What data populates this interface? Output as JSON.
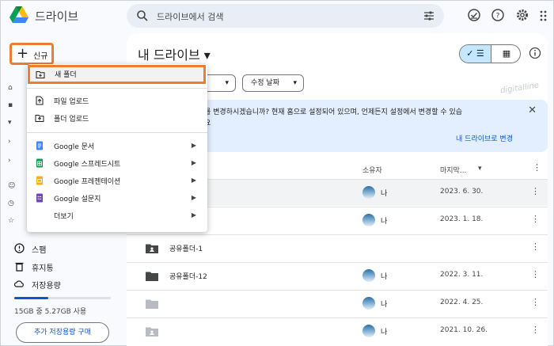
{
  "app": {
    "title": "드라이브"
  },
  "search": {
    "placeholder": "드라이브에서 검색"
  },
  "header_icons": [
    "offline-icon",
    "help-icon",
    "settings-icon",
    "apps-icon"
  ],
  "sidebar": {
    "new_label": "신규",
    "items": [
      {
        "label": "스팸",
        "icon": "spam-icon"
      },
      {
        "label": "휴지통",
        "icon": "trash-icon"
      },
      {
        "label": "저장용량",
        "icon": "cloud-icon"
      }
    ],
    "storage_text": "15GB 중 5.27GB 사용",
    "storage_fraction": 0.35,
    "buy_label": "추가 저장용량 구매"
  },
  "new_menu": {
    "items": [
      {
        "label": "새 폴더",
        "icon": "new-folder-icon",
        "submenu": false
      },
      {
        "label": "파일 업로드",
        "icon": "file-upload-icon",
        "submenu": false
      },
      {
        "label": "폴더 업로드",
        "icon": "folder-upload-icon",
        "submenu": false
      },
      {
        "label": "Google 문서",
        "icon": "docs-icon",
        "submenu": true
      },
      {
        "label": "Google 스프레드시트",
        "icon": "sheets-icon",
        "submenu": true
      },
      {
        "label": "Google 프레젠테이션",
        "icon": "slides-icon",
        "submenu": true
      },
      {
        "label": "Google 설문지",
        "icon": "forms-icon",
        "submenu": true
      },
      {
        "label": "더보기",
        "icon": "",
        "submenu": true
      }
    ]
  },
  "main": {
    "title": "내 드라이브",
    "filter_chips": [
      "람",
      "수정 날짜"
    ],
    "banner": {
      "message": "를 변경하시겠습니까? 현재 홈으로 설정되어 있으며, 언제든지 설정에서 변경할 수 있습",
      "message_line2": "요",
      "action": "내 드라이브로 변경"
    },
    "columns": {
      "owner": "소유자",
      "modified": "마지막..."
    },
    "rows": [
      {
        "name": "3)",
        "owner": "나",
        "date": "2023. 6. 30.",
        "icon": "shared-folder-icon"
      },
      {
        "name": "",
        "owner": "나",
        "date": "2023. 1. 18.",
        "icon": "folder-icon"
      },
      {
        "name": "공유폴더-1",
        "owner": "",
        "date": "",
        "icon": "shared-folder-icon"
      },
      {
        "name": "공유폴더-12",
        "owner": "나",
        "date": "2022. 3. 11.",
        "icon": "folder-icon"
      },
      {
        "name": "",
        "owner": "나",
        "date": "2022. 4. 25.",
        "icon": "folder-icon"
      },
      {
        "name": "",
        "owner": "나",
        "date": "2021. 10. 26.",
        "icon": "shared-folder-icon"
      }
    ]
  },
  "watermark": "digitalline",
  "colors": {
    "accent": "#0b57d0",
    "highlight": "#ed7d31",
    "banner_bg": "#e3efff"
  }
}
